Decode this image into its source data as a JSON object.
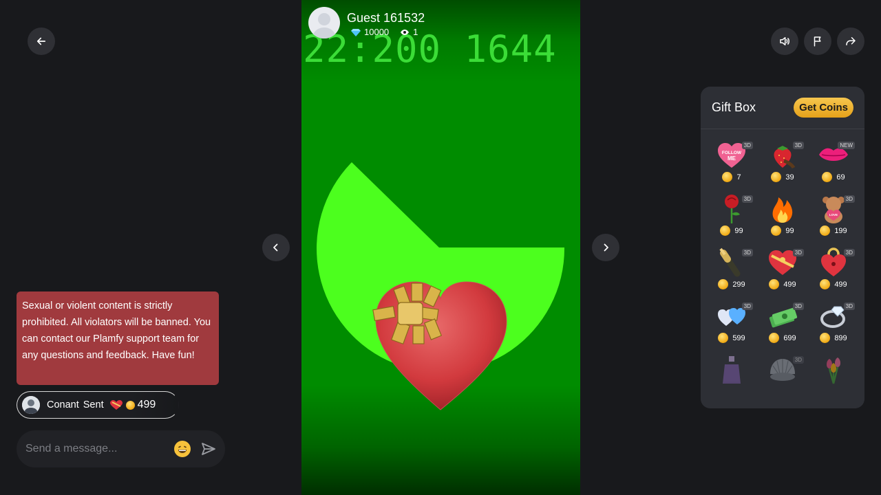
{
  "host": {
    "name": "Guest 161532",
    "diamonds": "10000",
    "viewers": "1"
  },
  "stage": {
    "timestamp": "22:200 1644"
  },
  "chat": {
    "notice": "Sexual or violent content is strictly prohibited. All violators will be banned. You can contact our Plamfy support team for any questions and feedback. Have fun!",
    "gift_event": {
      "sender": "Conant",
      "verb": "Sent",
      "amount": "499"
    },
    "composer": {
      "placeholder": "Send a message..."
    }
  },
  "giftbox": {
    "title": "Gift Box",
    "get_coins_label": "Get Coins",
    "gifts": [
      {
        "name": "follow-me-heart",
        "badge": "3D",
        "price": "7"
      },
      {
        "name": "strawberry",
        "badge": "3D",
        "price": "39"
      },
      {
        "name": "lips",
        "badge": "NEW",
        "price": "69"
      },
      {
        "name": "rose",
        "badge": "3D",
        "price": "99"
      },
      {
        "name": "fire",
        "badge": "",
        "price": "99"
      },
      {
        "name": "teddy-bear",
        "badge": "3D",
        "price": "199"
      },
      {
        "name": "champagne",
        "badge": "3D",
        "price": "299"
      },
      {
        "name": "heart-gift-box",
        "badge": "3D",
        "price": "499"
      },
      {
        "name": "heart-lock",
        "badge": "3D",
        "price": "499"
      },
      {
        "name": "heart-balloons",
        "badge": "3D",
        "price": "599"
      },
      {
        "name": "money-stack",
        "badge": "3D",
        "price": "699"
      },
      {
        "name": "diamond-ring",
        "badge": "3D",
        "price": "899"
      },
      {
        "name": "perfume",
        "badge": "",
        "price": ""
      },
      {
        "name": "pearl-shell",
        "badge": "3D",
        "price": ""
      },
      {
        "name": "tulip-bouquet",
        "badge": "",
        "price": ""
      }
    ]
  },
  "colors": {
    "background": "#18191c",
    "stage_green": "#008c00",
    "shape_green": "#4cff1e",
    "notice_red": "#a03a3e",
    "coin_gold": "#f0a913"
  }
}
